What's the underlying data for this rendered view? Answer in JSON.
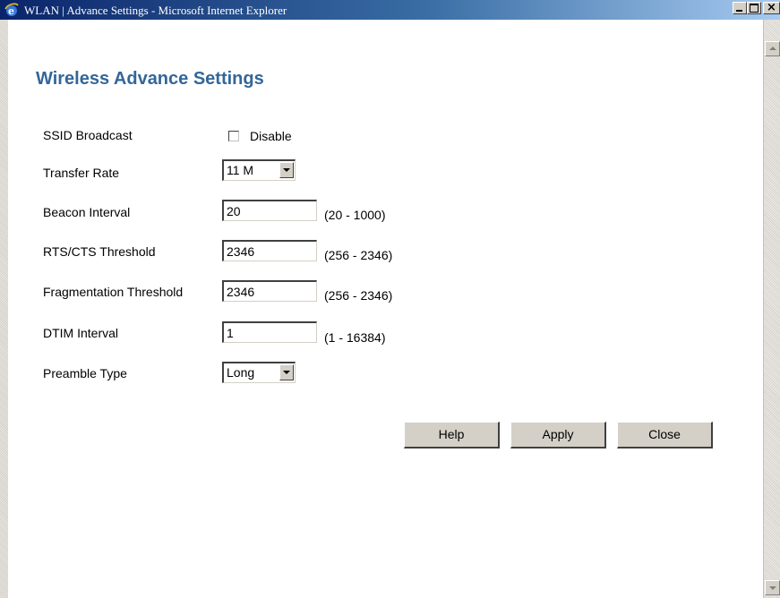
{
  "window": {
    "title": "WLAN | Advance Settings - Microsoft Internet Explorer",
    "close_glyph": "×"
  },
  "page": {
    "title": "Wireless Advance Settings"
  },
  "form": {
    "ssid_broadcast": {
      "label": "SSID Broadcast",
      "checkbox_label": "Disable",
      "checked": false
    },
    "transfer_rate": {
      "label": "Transfer Rate",
      "selected": "11 M"
    },
    "beacon_interval": {
      "label": "Beacon Interval",
      "value": "20",
      "range": "(20 - 1000)"
    },
    "rts_cts_threshold": {
      "label": "RTS/CTS Threshold",
      "value": "2346",
      "range": "(256 - 2346)"
    },
    "fragmentation_threshold": {
      "label": "Fragmentation Threshold",
      "value": "2346",
      "range": "(256 - 2346)"
    },
    "dtim_interval": {
      "label": "DTIM Interval",
      "value": "1",
      "range": "(1 - 16384)"
    },
    "preamble_type": {
      "label": "Preamble Type",
      "selected": "Long"
    }
  },
  "buttons": {
    "help": "Help",
    "apply": "Apply",
    "close": "Close"
  },
  "icons": {
    "window": "ie-icon",
    "minimize": "minimize-icon",
    "maximize": "maximize-icon",
    "close": "close-icon"
  }
}
